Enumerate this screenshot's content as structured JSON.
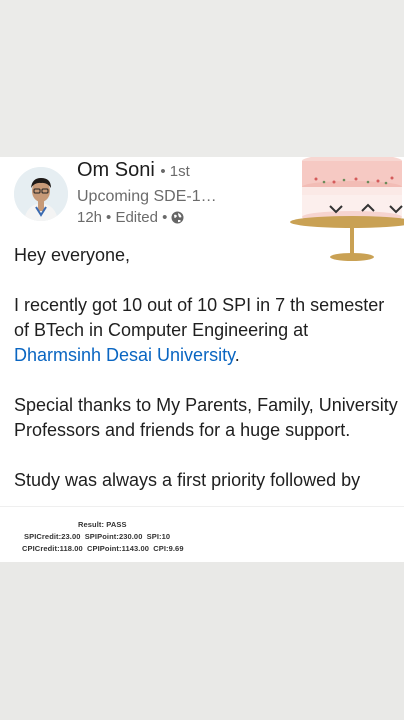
{
  "post": {
    "author_name": "Om Soni",
    "connection_degree": "• 1st",
    "headline": "Upcoming SDE-1…",
    "time": "12h",
    "edited": "• Edited •",
    "greeting": "Hey everyone,",
    "para1_pre": "I recently got 10 out of 10 SPI in 7 th semester of BTech in Computer Engineering at ",
    "para1_link": "Dharmsinh Desai University",
    "para1_post": ".",
    "para2": "Special thanks to My Parents, Family, University Professors and friends for a huge support.",
    "para3": "Study was always a first priority followed by"
  },
  "result": {
    "title": "Result: PASS",
    "line1": "SPICredit:23.00   SPIPoint:230.00   SPI:10",
    "line2": "CPICredit:118.00   CPIPoint:1143.00   CPI:9.69"
  },
  "icons": {
    "visibility": "globe-icon",
    "illustration": "birthday-cake-icon"
  },
  "colors": {
    "link": "#0a66c2",
    "cake_pink": "#f6c9c3",
    "cake_stand": "#c9a154"
  }
}
